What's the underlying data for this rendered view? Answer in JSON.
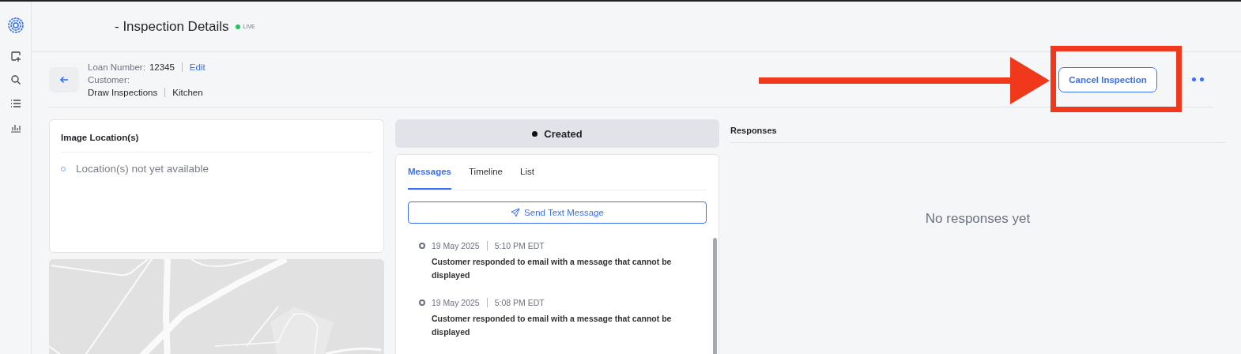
{
  "sidebar": {
    "items": [
      {
        "kind": "logo"
      },
      {
        "kind": "new"
      },
      {
        "kind": "search"
      },
      {
        "kind": "list"
      },
      {
        "kind": "chart"
      }
    ]
  },
  "header": {
    "title": "- Inspection Details",
    "status": "LIVE"
  },
  "info": {
    "loan_label": "Loan Number:",
    "loan_value": "12345",
    "edit": "Edit",
    "customer_label": "Customer:",
    "type": "Draw Inspections",
    "room": "Kitchen"
  },
  "actions": {
    "cancel": "Cancel Inspection"
  },
  "annotation": {
    "arrow": true,
    "frame": true
  },
  "locations": {
    "title": "Image Location(s)",
    "empty": "Location(s) not yet available"
  },
  "status": {
    "label": "Created"
  },
  "tabs": [
    {
      "label": "Messages",
      "selected": true
    },
    {
      "label": "Timeline",
      "selected": false
    },
    {
      "label": "List",
      "selected": false
    }
  ],
  "send_button": "Send Text Message",
  "messages": [
    {
      "date": "19 May 2025",
      "time": "5:10 PM EDT",
      "text": "Customer responded to email with a message that cannot be displayed"
    },
    {
      "date": "19 May 2025",
      "time": "5:08 PM EDT",
      "text": "Customer responded to email with a message that cannot be displayed"
    }
  ],
  "responses": {
    "title": "Responses",
    "empty": "No responses yet"
  }
}
